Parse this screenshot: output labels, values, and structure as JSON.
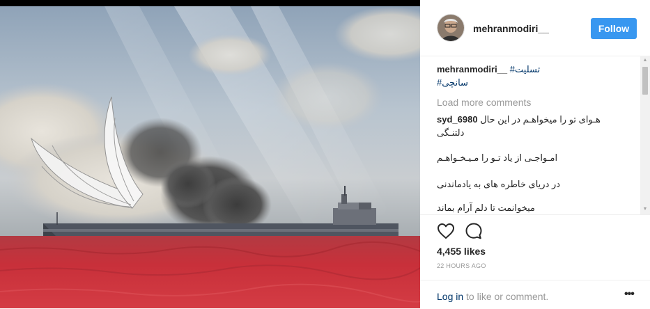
{
  "post": {
    "username": "mehranmodiri__",
    "follow_label": "Follow",
    "caption": {
      "user": "mehranmodiri__",
      "hashtag1": "#تسلیت",
      "hashtag2": "#سانچی"
    },
    "load_more": "Load more comments",
    "comment": {
      "user": "syd_6980",
      "line1": "هـوای تو را میخواهـم در این حال",
      "line2": "دلتنـگی",
      "line3": "امـواجـی از یاد تـو را مـیـخـواهـم",
      "line4": "در دریای خاطره های به یادماندنی",
      "line5": "میخوانمت تا دلم آرام بماند"
    },
    "likes": "4,455 likes",
    "timestamp": "22 HOURS AGO",
    "footer": {
      "login_link": "Log in",
      "login_rest": "to like or comment.",
      "more": "•••"
    }
  },
  "icons": {
    "heart": "heart-outline",
    "comment": "speech-bubble-outline",
    "more": "ellipsis",
    "scroll_up": "triangle-up",
    "scroll_down": "triangle-down"
  },
  "colors": {
    "follow_bg": "#3897f0",
    "hashtag": "#003569",
    "muted": "#999999",
    "sea_red": "#c8303a"
  }
}
